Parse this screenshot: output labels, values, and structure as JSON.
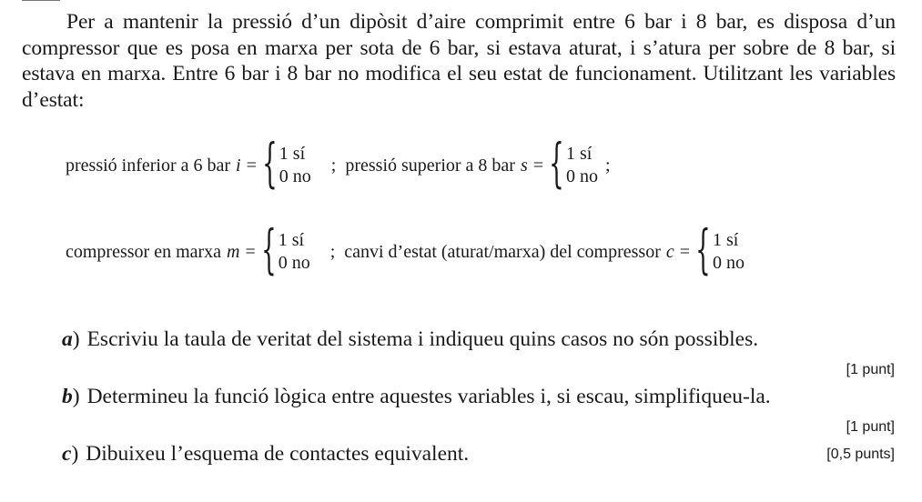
{
  "intro": "Per a mantenir la pressió d’un dipòsit d’aire comprimit entre 6 bar i 8 bar, es disposa d’un compressor que es posa en marxa per sota de 6 bar, si estava aturat, i s’atura per sobre de 8 bar, si estava en marxa. Entre 6 bar i 8 bar no modifica el seu estat de funcionament. Utilitzant les variables d’estat:",
  "variables": [
    {
      "label": "pressió inferior a 6 bar",
      "symbol": "i",
      "one": "1 sí",
      "zero": "0 no",
      "end": ";"
    },
    {
      "label": "pressió superior a 8 bar",
      "symbol": "s",
      "one": "1 sí",
      "zero": "0 no",
      "end": ";"
    },
    {
      "label": "compressor en marxa",
      "symbol": "m",
      "one": "1 sí",
      "zero": "0 no",
      "end": ";"
    },
    {
      "label": "canvi d’estat (aturat/marxa) del compressor",
      "symbol": "c",
      "one": "1 sí",
      "zero": "0 no",
      "end": ""
    }
  ],
  "questions": [
    {
      "letter": "a",
      "paren": ")",
      "text": "Escriviu la taula de veritat del sistema i indiqueu quins casos no són possibles.",
      "points": "[1 punt]"
    },
    {
      "letter": "b",
      "paren": ")",
      "text": "Determineu la funció lògica entre aquestes variables i, si escau, simplifiqueu-la.",
      "points": "[1 punt]"
    },
    {
      "letter": "c",
      "paren": ")",
      "text": "Dibuixeu l’esquema de contactes equivalent.",
      "points": "[0,5 punts]"
    }
  ]
}
